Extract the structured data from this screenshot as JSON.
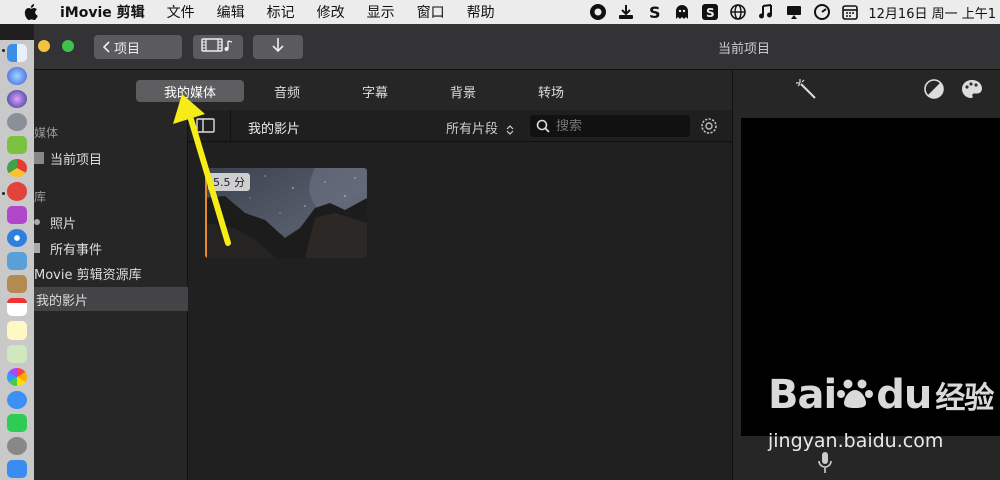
{
  "menubar": {
    "app_name": "iMovie 剪辑",
    "items": [
      "文件",
      "编辑",
      "标记",
      "修改",
      "显示",
      "窗口",
      "帮助"
    ],
    "clock": "12月16日 周一 上午1"
  },
  "toolbar": {
    "back_label": "项目",
    "window_title": "当前项目"
  },
  "tabs": [
    {
      "label": "我的媒体",
      "active": true
    },
    {
      "label": "音频",
      "active": false
    },
    {
      "label": "字幕",
      "active": false
    },
    {
      "label": "背景",
      "active": false
    },
    {
      "label": "转场",
      "active": false
    }
  ],
  "sidebar": {
    "section_media": "媒体",
    "current_project": "当前项目",
    "section_library": "库",
    "photos": "照片",
    "all_events": "所有事件",
    "library_name": "Movie 剪辑资源库",
    "my_movie": "我的影片"
  },
  "browser": {
    "title": "我的影片",
    "filter": "所有片段",
    "search_placeholder": "搜索",
    "clip_duration": "5.5 分"
  },
  "watermark": {
    "brand": "Bai",
    "brand2": "du",
    "cn": "经验",
    "url": "jingyan.baidu.com"
  }
}
